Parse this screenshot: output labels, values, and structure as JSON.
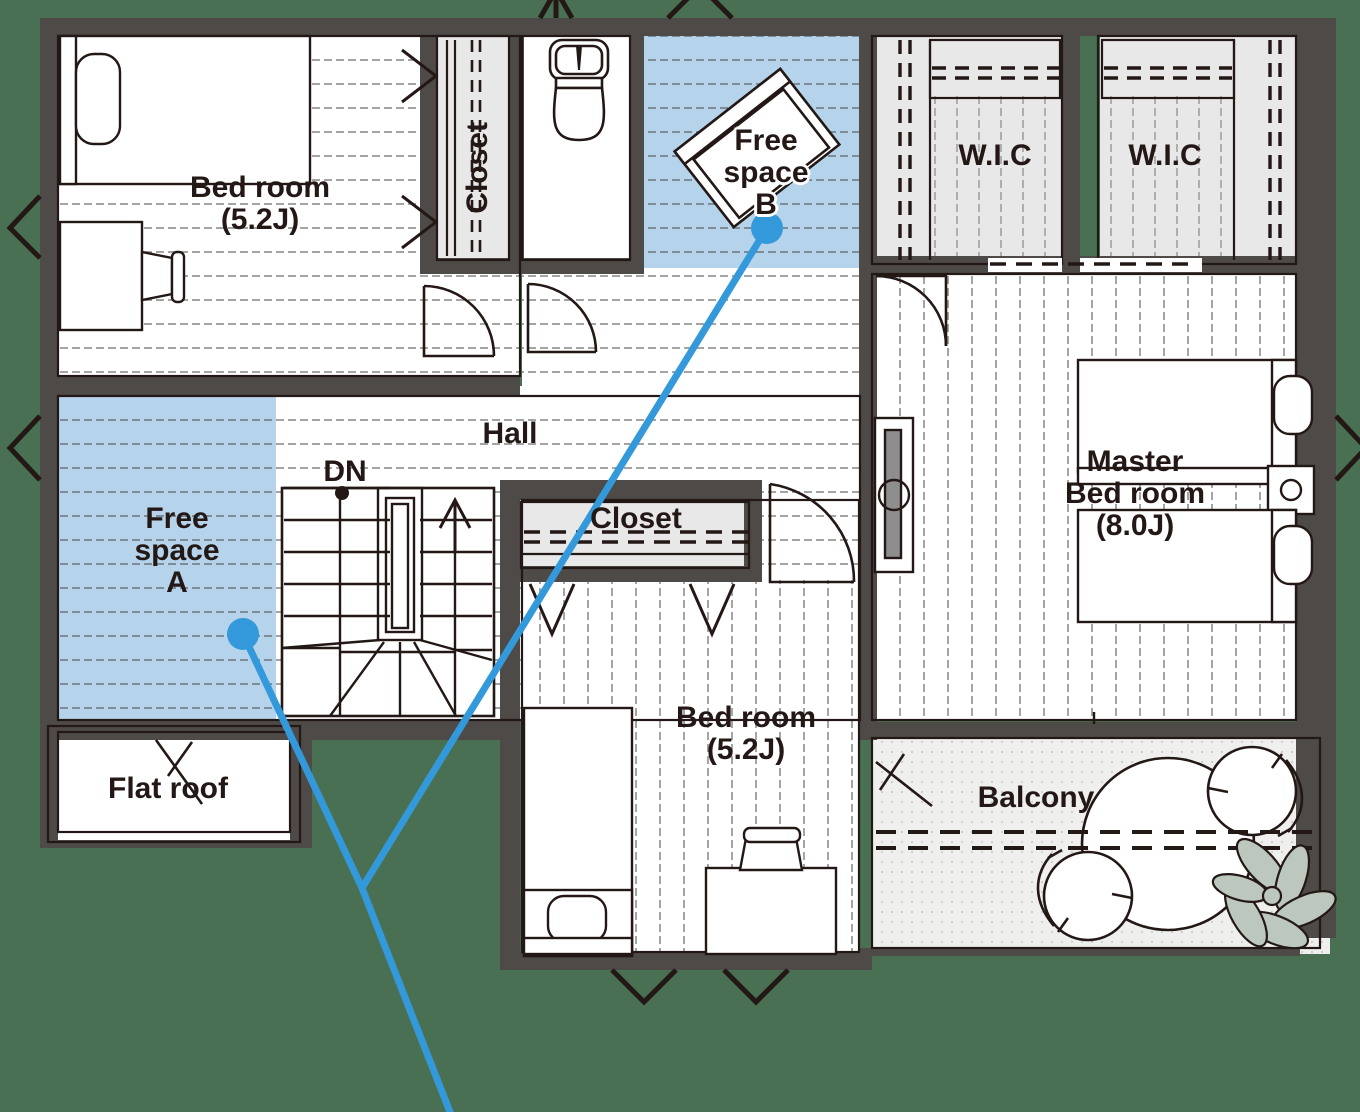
{
  "plan": {
    "title": "2nd floor plan",
    "background_color": "#4a7053",
    "wall_color": "#4d4a47",
    "line_color": "#231815",
    "highlight_color": "#b6d3ec",
    "marker_color": "#3399da",
    "floor_fill": "#ffffff",
    "closet_fill": "#e8e8e8",
    "balcony_fill": "#efefee",
    "plant_fill": "#bcc8bd"
  },
  "rooms": [
    {
      "key": "bedroom_nw",
      "name": "Bed room",
      "area": "(5.2J)",
      "label": "Bed room\n(5.2J)"
    },
    {
      "key": "closet_top",
      "name": "Closet",
      "area": "",
      "label": "Closet"
    },
    {
      "key": "free_space_b",
      "name": "Free space B",
      "area": "",
      "label": "Free\nspace\nB"
    },
    {
      "key": "wic_left",
      "name": "W.I.C",
      "area": "",
      "label": "W.I.C"
    },
    {
      "key": "wic_right",
      "name": "W.I.C",
      "area": "",
      "label": "W.I.C"
    },
    {
      "key": "hall",
      "name": "Hall",
      "area": "",
      "label": "Hall"
    },
    {
      "key": "free_space_a",
      "name": "Free space A",
      "area": "",
      "label": "Free\nspace\nA"
    },
    {
      "key": "stairs_down",
      "name": "DN",
      "area": "",
      "label": "DN"
    },
    {
      "key": "closet_mid",
      "name": "Closet",
      "area": "",
      "label": "Closet"
    },
    {
      "key": "master_bedroom",
      "name": "Master Bed room",
      "area": "(8.0J)",
      "label": "Master\nBed room\n(8.0J)"
    },
    {
      "key": "bedroom_s",
      "name": "Bed room",
      "area": "(5.2J)",
      "label": "Bed room\n(5.2J)"
    },
    {
      "key": "flat_roof",
      "name": "Flat roof",
      "area": "",
      "label": "Flat roof"
    },
    {
      "key": "balcony",
      "name": "Balcony",
      "area": "",
      "label": "Balcony"
    }
  ],
  "labels": {
    "bedroom_nw": "Bed room\n(5.2J)",
    "closet_top": "Closet",
    "free_space_b": "Free\nspace\nB",
    "wic_left": "W.I.C",
    "wic_right": "W.I.C",
    "hall": "Hall",
    "free_space_a": "Free\nspace\nA",
    "stairs_dn": "DN",
    "closet_mid": "Closet",
    "master_bedroom": "Master\nBed room\n(8.0J)",
    "bedroom_s": "Bed room\n(5.2J)",
    "flat_roof": "Flat roof",
    "balcony": "Balcony"
  },
  "callouts": [
    {
      "key": "free_space_a_marker",
      "label": "Free space A",
      "dot": [
        243,
        634
      ]
    },
    {
      "key": "free_space_b_marker",
      "label": "Free space B",
      "dot": [
        767,
        228
      ]
    }
  ],
  "highlighted_areas": [
    "Free space A",
    "Free space B"
  ]
}
